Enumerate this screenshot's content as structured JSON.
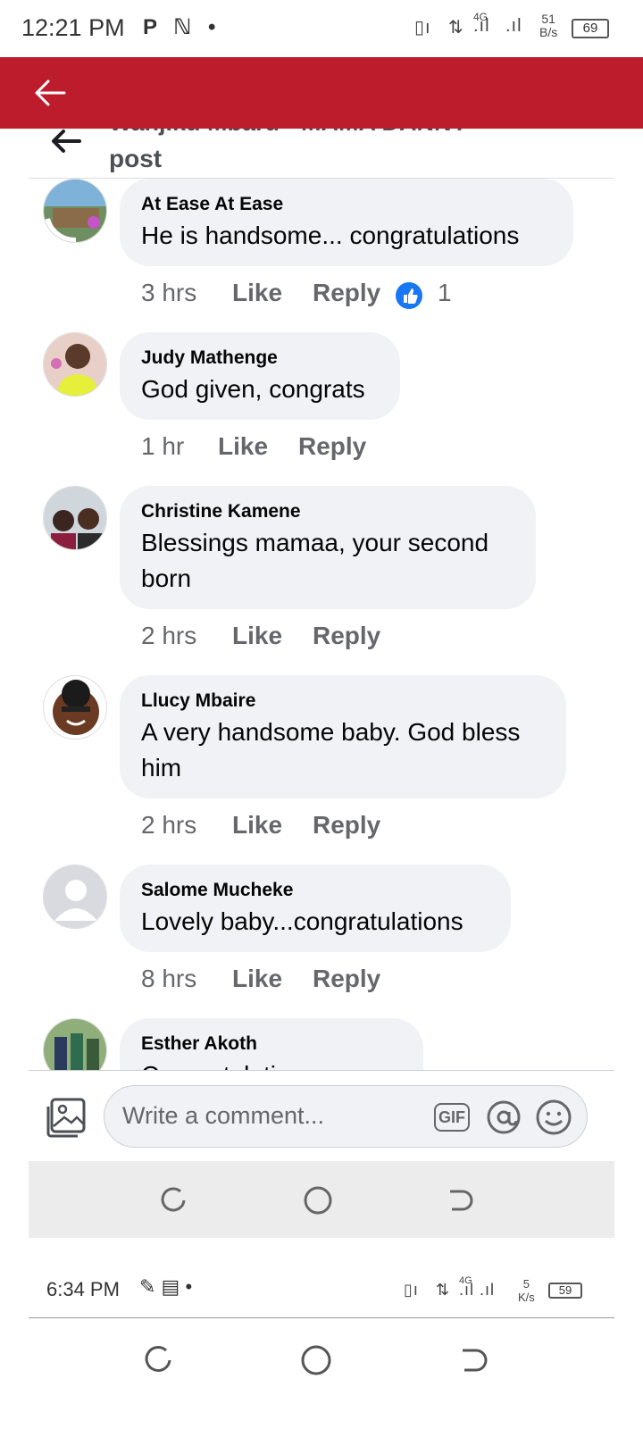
{
  "status_bar": {
    "time": "12:21 PM",
    "net_speed_value": "51",
    "net_speed_unit": "B/s",
    "battery": "69",
    "network_type": "4G"
  },
  "post_header": {
    "title_partial": "Wanjiku Mbaru - MAMA DANNY",
    "title_line2": "post"
  },
  "comments": [
    {
      "name": "At Ease At Ease",
      "text": [
        "He is handsome... congratulations"
      ],
      "time": "3 hrs",
      "like": "Like",
      "reply": "Reply",
      "reactions": "1"
    },
    {
      "name": "Judy Mathenge",
      "text": [
        "God given, congrats"
      ],
      "time": "1 hr",
      "like": "Like",
      "reply": "Reply"
    },
    {
      "name": "Christine Kamene",
      "text": [
        "Blessings mamaa, your second",
        "born"
      ],
      "time": "2 hrs",
      "like": "Like",
      "reply": "Reply"
    },
    {
      "name": "Llucy Mbaire",
      "text": [
        "A very handsome baby. God bless",
        "him"
      ],
      "time": "2 hrs",
      "like": "Like",
      "reply": "Reply"
    },
    {
      "name": "Salome Mucheke",
      "text": [
        "Lovely baby...congratulations"
      ],
      "time": "8 hrs",
      "like": "Like",
      "reply": "Reply"
    },
    {
      "name": "Esther Akoth",
      "text": [
        "Congratulations mum"
      ]
    }
  ],
  "composer": {
    "placeholder": "Write a comment...",
    "gif_label": "GIF"
  },
  "inner_status": {
    "time": "6:34 PM",
    "net_speed_value": "5",
    "net_speed_unit": "K/s",
    "battery": "59",
    "network_type": "4G"
  },
  "colors": {
    "header_red": "#bd1c2d",
    "bubble_bg": "#f0f2f5",
    "secondary_text": "#65676b",
    "like_blue": "#1877f2"
  }
}
